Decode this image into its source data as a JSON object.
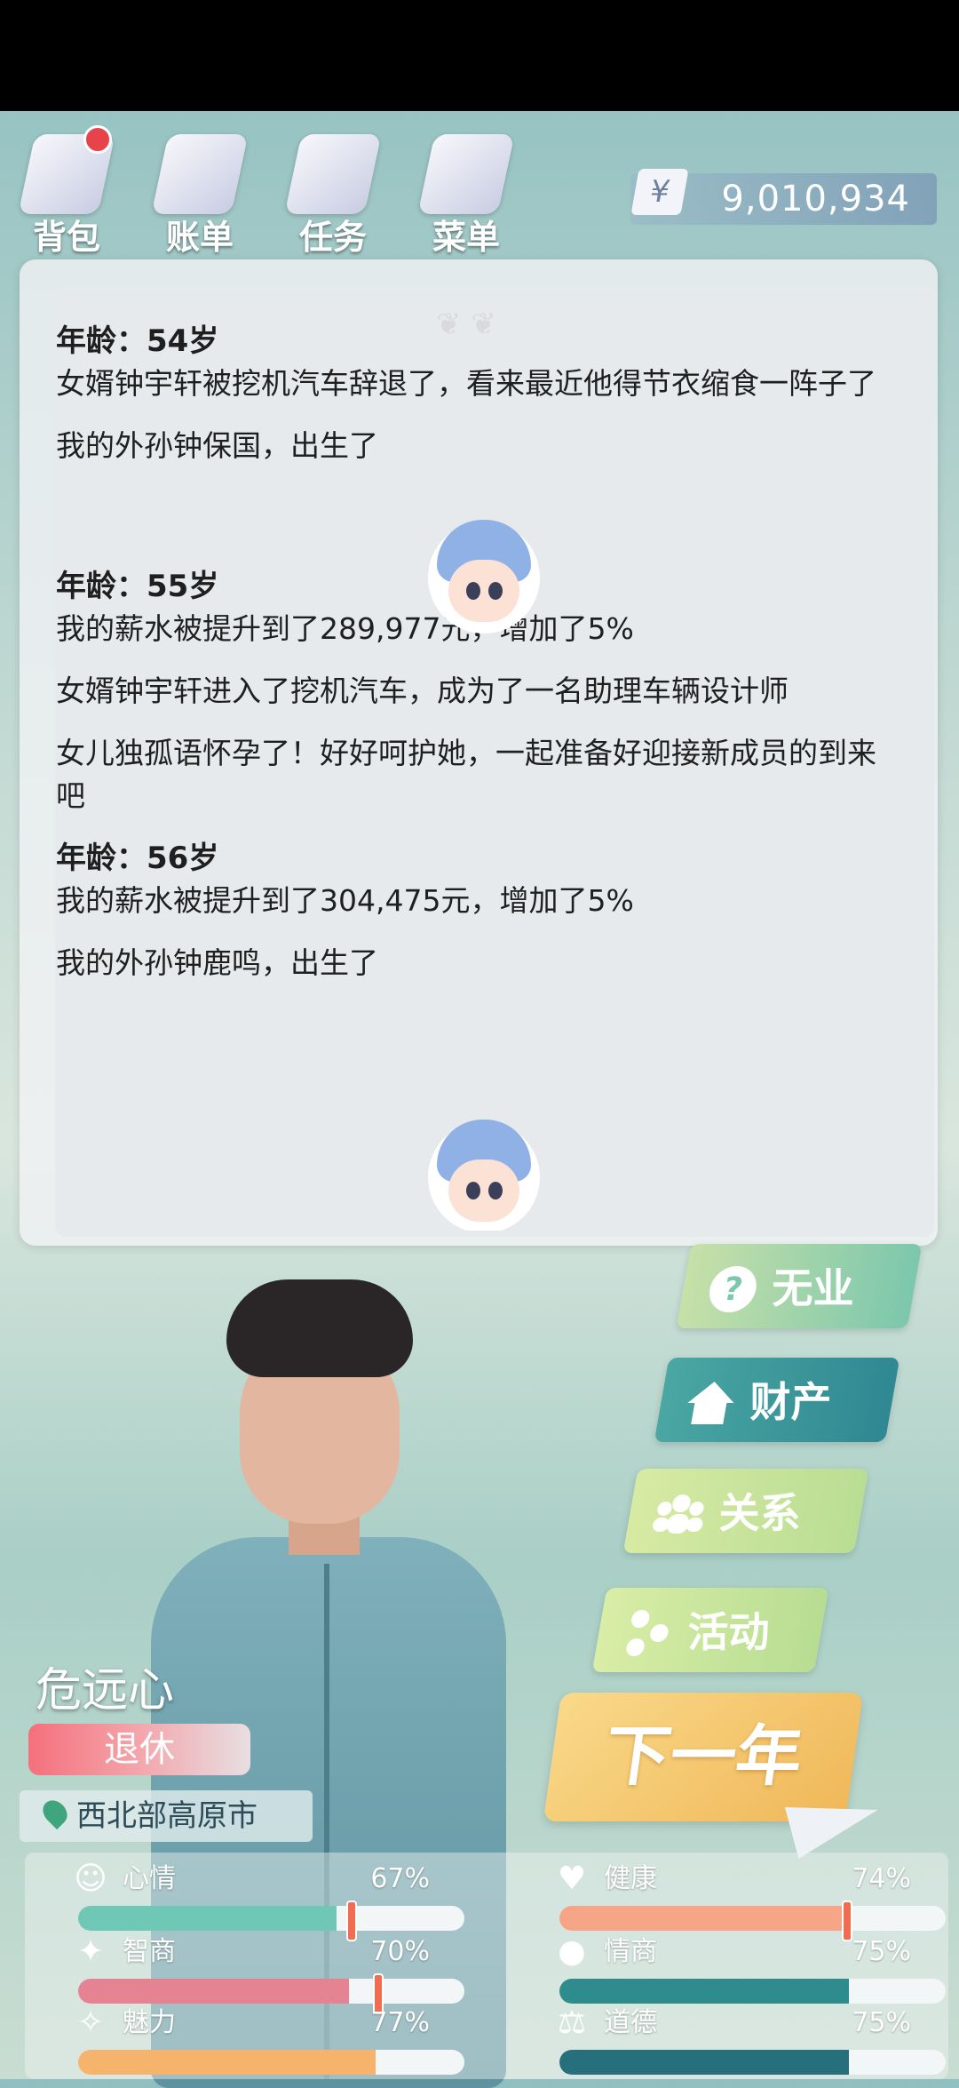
{
  "top_nav": [
    {
      "label": "背包",
      "icon": "bag-icon"
    },
    {
      "label": "账单",
      "icon": "bill-icon"
    },
    {
      "label": "任务",
      "icon": "task-icon"
    },
    {
      "label": "菜单",
      "icon": "menu-icon"
    }
  ],
  "currency": {
    "symbol": "¥",
    "amount": "9,010,934"
  },
  "life_log": [
    {
      "age_label": "年龄：54岁",
      "events": [
        "女婿钟宇轩被挖机汽车辞退了，看来最近他得节衣缩食一阵子了",
        "我的外孙钟保国，出生了"
      ]
    },
    {
      "age_label": "年龄：55岁",
      "events": [
        "我的薪水被提升到了289,977元，增加了5%",
        "女婿钟宇轩进入了挖机汽车，成为了一名助理车辆设计师",
        "女儿独孤语怀孕了！好好呵护她，一起准备好迎接新成员的到来吧"
      ]
    },
    {
      "age_label": "年龄：56岁",
      "events": [
        "我的薪水被提升到了304,475元，增加了5%",
        "我的外孙钟鹿鸣，出生了"
      ]
    }
  ],
  "actions": {
    "job": "无业",
    "property": "财产",
    "relations": "关系",
    "activity": "活动",
    "next_year": "下一年"
  },
  "character": {
    "name": "危远心",
    "status": "退休",
    "location": "西北部高原市"
  },
  "stats": [
    {
      "name": "心情",
      "value": "67%",
      "fraction": 0.67,
      "color": "#6fc7b6",
      "icon": "smile-icon"
    },
    {
      "name": "健康",
      "value": "74%",
      "fraction": 0.74,
      "color": "#f6a586",
      "icon": "heart-icon"
    },
    {
      "name": "智商",
      "value": "70%",
      "fraction": 0.7,
      "color": "#e58392",
      "icon": "bulb-icon"
    },
    {
      "name": "情商",
      "value": "75%",
      "fraction": 0.75,
      "color": "#2f8c8c",
      "icon": "apple-icon"
    },
    {
      "name": "魅力",
      "value": "77%",
      "fraction": 0.77,
      "color": "#f6b36c",
      "icon": "sparkle-icon"
    },
    {
      "name": "道德",
      "value": "75%",
      "fraction": 0.75,
      "color": "#25707c",
      "icon": "scale-icon"
    }
  ]
}
